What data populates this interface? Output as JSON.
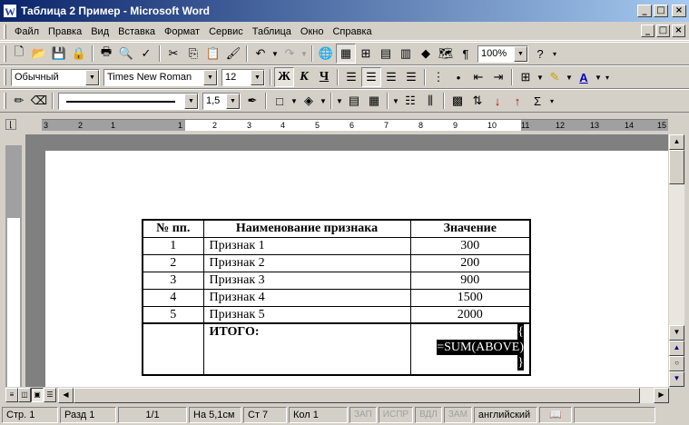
{
  "window": {
    "title": "Таблица 2 Пример - Microsoft Word",
    "app_icon": "W"
  },
  "menu": [
    "Файл",
    "Правка",
    "Вид",
    "Вставка",
    "Формат",
    "Сервис",
    "Таблица",
    "Окно",
    "Справка"
  ],
  "standard_toolbar": {
    "zoom": "100%"
  },
  "formatting_toolbar": {
    "style": "Обычный",
    "font": "Times New Roman",
    "size": "12",
    "bold": "Ж",
    "italic": "К",
    "underline": "Ч"
  },
  "borders_toolbar": {
    "line_weight": "1,5"
  },
  "ruler": {
    "numbers": [
      "3",
      "2",
      "1",
      "1",
      "2",
      "3",
      "4",
      "5",
      "6",
      "7",
      "8",
      "9",
      "10",
      "11",
      "12",
      "13",
      "14",
      "15"
    ]
  },
  "table": {
    "headers": [
      "№ пп.",
      "Наименование признака",
      "Значение"
    ],
    "rows": [
      {
        "num": "1",
        "name": "Признак 1",
        "value": "300"
      },
      {
        "num": "2",
        "name": "Признак 2",
        "value": "200"
      },
      {
        "num": "3",
        "name": "Признак 3",
        "value": "900"
      },
      {
        "num": "4",
        "name": "Признак 4",
        "value": "1500"
      },
      {
        "num": "5",
        "name": "Признак 5",
        "value": "2000"
      }
    ],
    "total_label": "ИТОГО:",
    "field_open": "{",
    "field_code": "=SUM(ABOVE)",
    "field_close": "}"
  },
  "status": {
    "page": "Стр. 1",
    "section": "Разд 1",
    "pages": "1/1",
    "at": "На 5,1см",
    "line": "Ст 7",
    "col": "Кол 1",
    "rec": "ЗАП",
    "trk": "ИСПР",
    "ext": "ВДЛ",
    "ovr": "ЗАМ",
    "language": "английский"
  }
}
